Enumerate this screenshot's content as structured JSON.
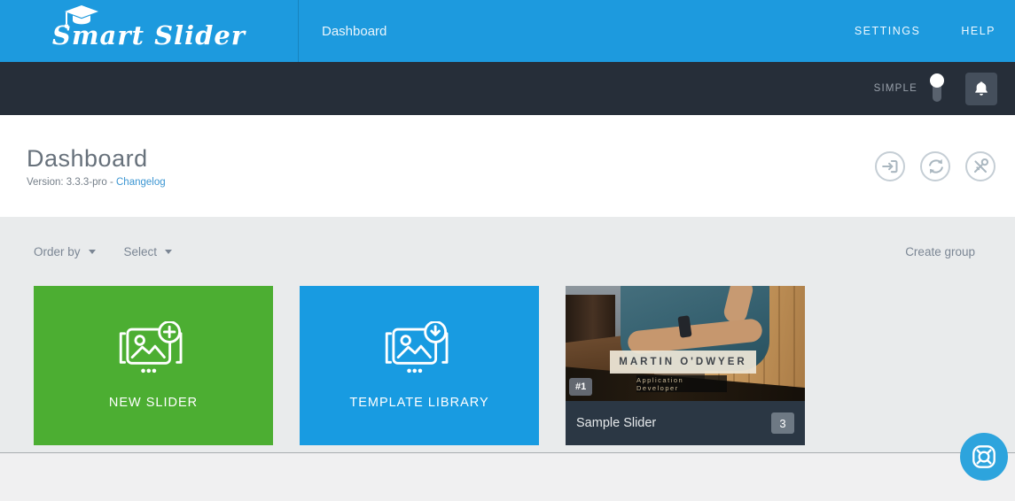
{
  "topbar": {
    "brand": "Smart Slider",
    "nav_dashboard": "Dashboard",
    "settings": "SETTINGS",
    "help": "HELP"
  },
  "adminbar": {
    "mode": "SIMPLE"
  },
  "header": {
    "title": "Dashboard",
    "version_prefix": "Version: 3.3.3-pro - ",
    "changelog": "Changelog"
  },
  "toolbar": {
    "order_by": "Order by",
    "select": "Select",
    "create_group": "Create group"
  },
  "cards": {
    "new_slider": {
      "label": "NEW SLIDER",
      "color": "#4cae32"
    },
    "template_library": {
      "label": "TEMPLATE LIBRARY",
      "color": "#189be1"
    },
    "sample_slider": {
      "title": "Sample Slider",
      "slide_count": "3",
      "order_badge": "#1",
      "slide_heading": "MARTIN O'DWYER",
      "slide_subheading": "Application Developer"
    }
  },
  "icons": {
    "graduation-cap": "brand cap glyph",
    "caret-down": "dropdown triangle",
    "toggle": "simple mode vertical switch",
    "bell": "notifications",
    "import": "import slider",
    "sync": "refresh/sync",
    "key": "license key",
    "slide-add": "new slider glyph",
    "slide-download": "template library glyph",
    "lifebuoy": "support help"
  },
  "colors": {
    "brand_blue": "#1d9ade",
    "dark_bar": "#262e39",
    "green": "#4cae32",
    "card_blue": "#189be1",
    "slider_footer": "#2b3744",
    "help_blue": "#2da4dd",
    "content_gray": "#e9ebec"
  }
}
